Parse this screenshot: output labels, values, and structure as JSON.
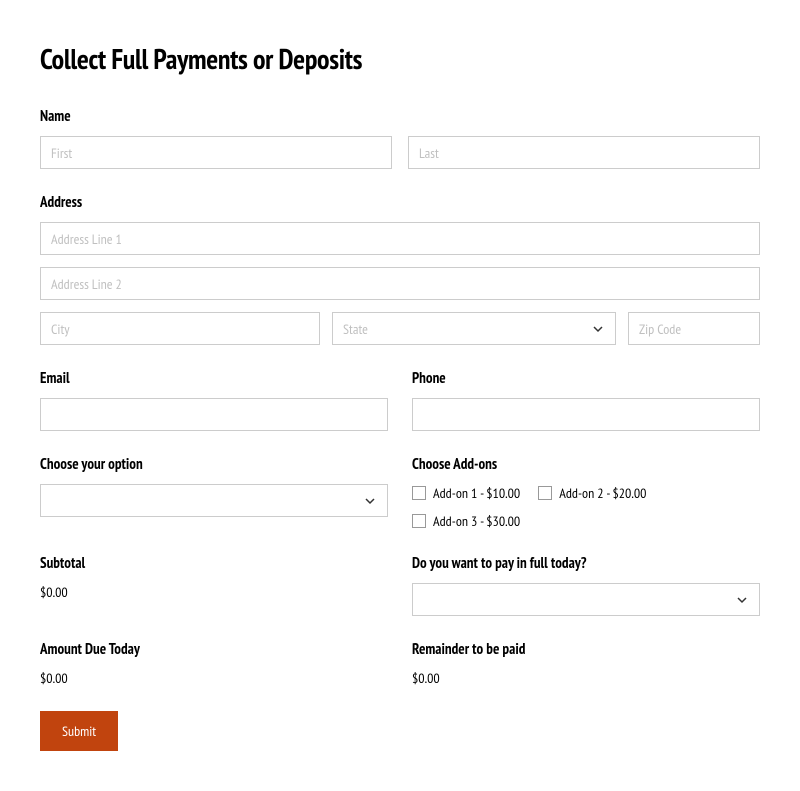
{
  "title": "Collect Full Payments or Deposits",
  "name": {
    "label": "Name",
    "first_placeholder": "First",
    "last_placeholder": "Last"
  },
  "address": {
    "label": "Address",
    "line1_placeholder": "Address Line 1",
    "line2_placeholder": "Address Line 2",
    "city_placeholder": "City",
    "state_placeholder": "State",
    "zip_placeholder": "Zip Code"
  },
  "email": {
    "label": "Email"
  },
  "phone": {
    "label": "Phone"
  },
  "option": {
    "label": "Choose your option"
  },
  "addons": {
    "label": "Choose Add-ons",
    "items": [
      {
        "label": "Add-on 1 - $10.00"
      },
      {
        "label": "Add-on 2 - $20.00"
      },
      {
        "label": "Add-on 3 - $30.00"
      }
    ]
  },
  "subtotal": {
    "label": "Subtotal",
    "value": "$0.00"
  },
  "pay_full": {
    "label": "Do you want to pay in full today?"
  },
  "amount_due": {
    "label": "Amount Due Today",
    "value": "$0.00"
  },
  "remainder": {
    "label": "Remainder to be paid",
    "value": "$0.00"
  },
  "submit": {
    "label": "Submit"
  }
}
